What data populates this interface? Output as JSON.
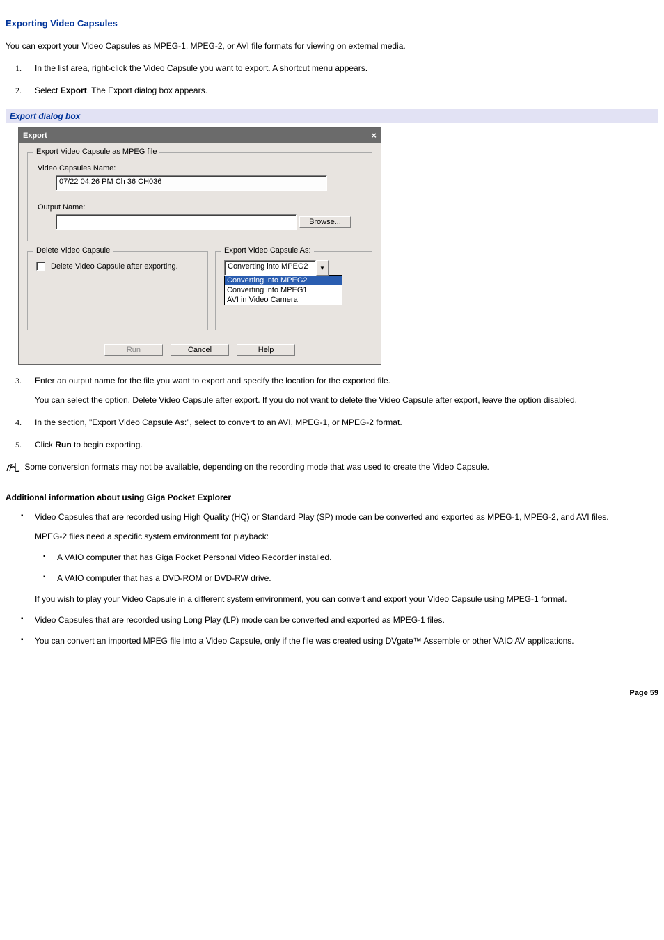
{
  "title": "Exporting Video Capsules",
  "intro": "You can export your Video Capsules as MPEG-1, MPEG-2, or AVI file formats for viewing on external media.",
  "steps_top": [
    {
      "num": "1.",
      "text_before": "In the list area, right-click the Video Capsule you want to export. A shortcut menu appears."
    },
    {
      "num": "2.",
      "text_before": "Select ",
      "strong": "Export",
      "text_after": ". The Export dialog box appears."
    }
  ],
  "caption": "Export dialog box",
  "dialog": {
    "title": "Export",
    "group1_label": "Export Video Capsule as MPEG file",
    "vc_name_label": "Video Capsules Name:",
    "vc_name_value": "07/22 04:26 PM Ch 36 CH036",
    "output_label": "Output Name:",
    "output_value": "",
    "browse": "Browse...",
    "delete_group_label": "Delete Video Capsule",
    "delete_checkbox_label": "Delete Video Capsule after exporting.",
    "export_as_group_label": "Export Video Capsule As:",
    "combo_value": "Converting into MPEG2",
    "options": [
      "Converting into MPEG2",
      "Converting into MPEG1",
      "AVI in Video Camera"
    ],
    "btn_run": "Run",
    "btn_cancel": "Cancel",
    "btn_help": "Help"
  },
  "steps_bottom": [
    {
      "num": "3.",
      "text": "Enter an output name for the file you want to export and specify the location for the exported file.",
      "extra": "You can select the option, Delete Video Capsule after export. If you do not want to delete the Video Capsule after export, leave the option disabled."
    },
    {
      "num": "4.",
      "text": "In the section, \"Export Video Capsule As:\", select to convert to an AVI, MPEG-1, or MPEG-2 format."
    },
    {
      "num": "5.",
      "text_before": "Click ",
      "strong": "Run",
      "text_after": " to begin exporting."
    }
  ],
  "note": " Some conversion formats may not be available, depending on the recording mode that was used to create the Video Capsule.",
  "subheading": "Additional information about using Giga Pocket Explorer",
  "add_info_1a": "Video Capsules that are recorded using High Quality (HQ) or Standard Play (SP) mode can be converted and exported as MPEG-1, MPEG-2, and AVI files.",
  "add_info_1b": "MPEG-2 files need a specific system environment for playback:",
  "sub_bullets": [
    "A VAIO computer that has Giga Pocket Personal Video Recorder installed.",
    "A VAIO computer that has a DVD-ROM or DVD-RW drive."
  ],
  "add_info_1c": "If you wish to play your Video Capsule in a different system environment, you can convert and export your Video Capsule using MPEG-1 format.",
  "add_info_2": "Video Capsules that are recorded using Long Play (LP) mode can be converted and exported as MPEG-1 files.",
  "add_info_3": "You can convert an imported MPEG file into a Video Capsule, only if the file was created using DVgate™ Assemble or other VAIO AV applications.",
  "page": "Page 59"
}
